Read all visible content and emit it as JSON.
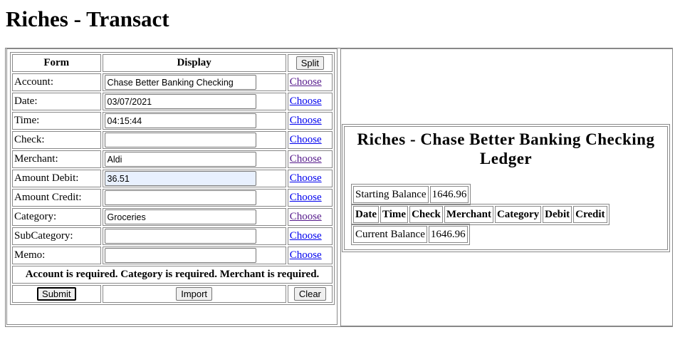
{
  "page": {
    "title": "Riches - Transact"
  },
  "form": {
    "header": {
      "col1": "Form",
      "col2": "Display",
      "split_label": "Split"
    },
    "choose_label": "Choose",
    "rows": [
      {
        "label": "Account:",
        "value": "Chase Better Banking Checking",
        "link_visited": true
      },
      {
        "label": "Date:",
        "value": "03/07/2021",
        "link_visited": false
      },
      {
        "label": "Time:",
        "value": "04:15:44",
        "link_visited": false
      },
      {
        "label": "Check:",
        "value": "",
        "link_visited": false
      },
      {
        "label": "Merchant:",
        "value": "Aldi",
        "link_visited": true
      },
      {
        "label": "Amount Debit:",
        "value": "36.51",
        "link_visited": false
      },
      {
        "label": "Amount Credit:",
        "value": "",
        "link_visited": false
      },
      {
        "label": "Category:",
        "value": "Groceries",
        "link_visited": true
      },
      {
        "label": "SubCategory:",
        "value": "",
        "link_visited": false
      },
      {
        "label": "Memo:",
        "value": "",
        "link_visited": false
      }
    ],
    "message": "Account is required. Category is required. Merchant is required.",
    "submit_label": "Submit",
    "import_label": "Import",
    "clear_label": "Clear"
  },
  "ledger": {
    "title": "Riches - Chase Better Banking Checking Ledger",
    "starting_balance_label": "Starting Balance",
    "starting_balance": "1646.96",
    "columns": [
      "Date",
      "Time",
      "Check",
      "Merchant",
      "Category",
      "Debit",
      "Credit"
    ],
    "current_balance_label": "Current Balance",
    "current_balance": "1646.96"
  },
  "colors": {
    "link": "#0000ee",
    "visited_link": "#551a8b",
    "autofill": "#e8f0fe",
    "border": "#888888"
  }
}
